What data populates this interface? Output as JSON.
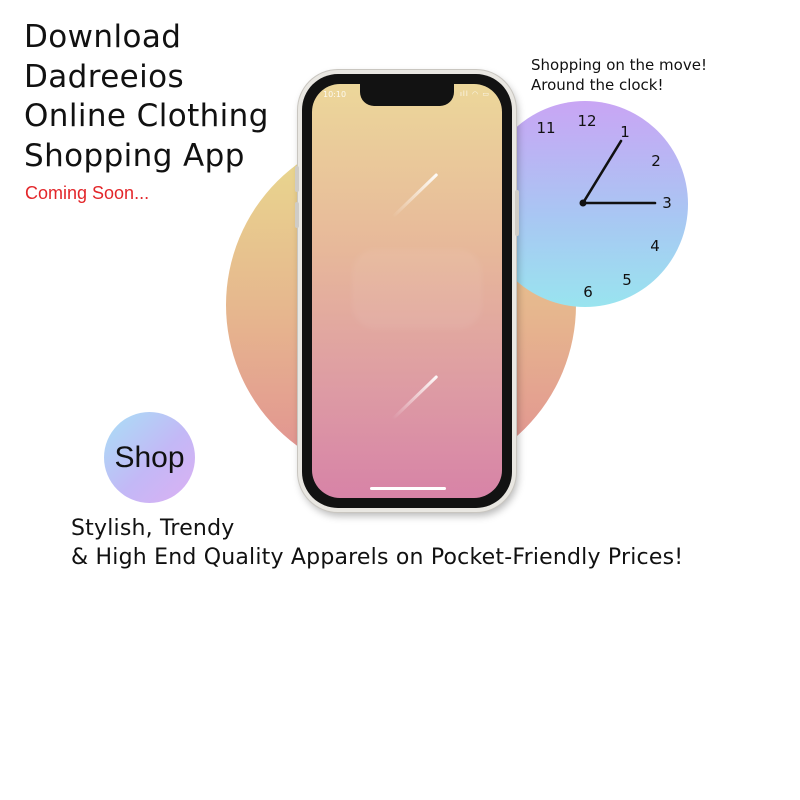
{
  "headline": {
    "lines": [
      "Download",
      "Dadreeios",
      "Online Clothing",
      "Shopping App"
    ]
  },
  "coming_soon": "Coming Soon...",
  "tagline": {
    "lines": [
      "Shopping on the move!",
      "Around the clock!"
    ]
  },
  "clock": {
    "numbers": [
      "11",
      "12",
      "1",
      "3",
      "4",
      "5",
      "6",
      "2"
    ],
    "hour_hand_points_to": "1",
    "minute_hand_points_to": "3"
  },
  "phone": {
    "status_time": "10:10",
    "status_icons": "ıll ◠ ▭"
  },
  "shop_button": "Shop",
  "bottom_text": {
    "lines": [
      "Stylish, Trendy",
      "& High End Quality Apparels on Pocket-Friendly Prices!"
    ]
  },
  "colors": {
    "coming_soon": "#e3262a",
    "text": "#111111"
  }
}
